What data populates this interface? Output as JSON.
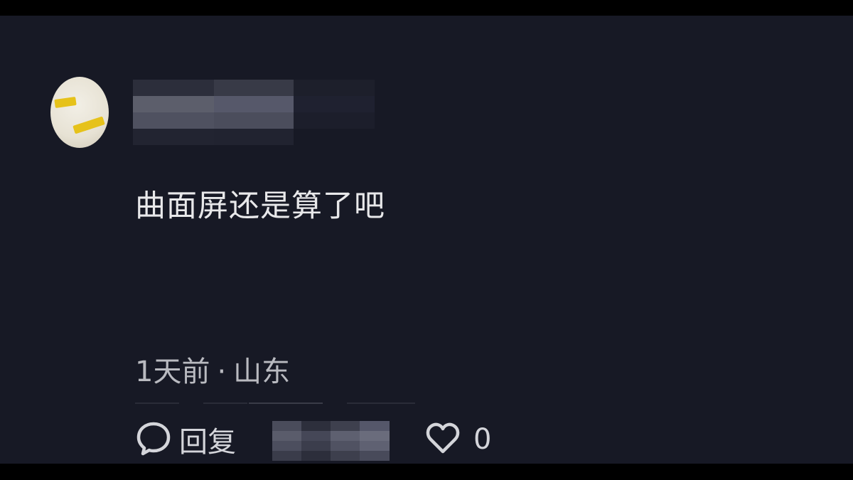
{
  "comment": {
    "text": "曲面屏还是算了吧",
    "time": "1天前",
    "separator": "·",
    "location": "山东"
  },
  "actions": {
    "reply_label": "回复",
    "like_count": "0"
  },
  "icons": {
    "reply": "speech-bubble-icon",
    "like": "heart-icon"
  },
  "colors": {
    "background": "#171925",
    "text_primary": "#e8e8ea",
    "text_secondary": "#b9bac0",
    "avatar_tape": "#e6c21a"
  },
  "username": {
    "redacted": true
  }
}
